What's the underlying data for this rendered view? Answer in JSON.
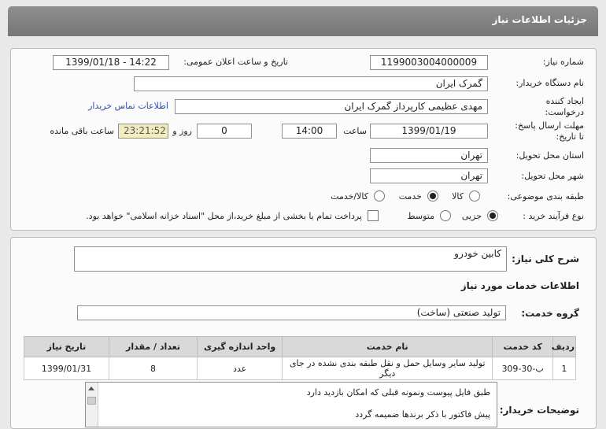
{
  "header": {
    "title": "جزئیات اطلاعات نیاز"
  },
  "need_number": {
    "label": "شماره نیاز:",
    "value": "1199003004000009"
  },
  "announce": {
    "label": "تاریخ و ساعت اعلان عمومی:",
    "value": "1399/01/18 - 14:22"
  },
  "buyer_org": {
    "label": "نام دستگاه خریدار:",
    "value": "گمرک ایران"
  },
  "requester": {
    "label_line1": "ایجاد کننده",
    "label_line2": "درخواست:",
    "value": "مهدی عظیمی کارپرداز گمرک ایران",
    "contact_link": "اطلاعات تماس خریدار"
  },
  "deadline": {
    "label_line1": "مهلت ارسال پاسخ:",
    "label_line2": "تا تاریخ:",
    "date": "1399/01/19",
    "time_label": "ساعت",
    "time": "14:00",
    "days": "0",
    "days_label": "روز و",
    "remaining": "23:21:52",
    "remaining_label": "ساعت باقی مانده"
  },
  "province": {
    "label": "استان محل تحویل:",
    "value": "تهران"
  },
  "city": {
    "label": "شهر محل تحویل:",
    "value": "تهران"
  },
  "category": {
    "label": "طبقه بندی موضوعی:",
    "options": [
      "کالا",
      "خدمت",
      "کالا/خدمت"
    ],
    "selected": "خدمت"
  },
  "purchase_type": {
    "label": "نوع فرآیند خرید :",
    "options": [
      "جزیی",
      "متوسط"
    ],
    "selected": "جزیی",
    "treasury_note": "پرداخت تمام یا بخشی از مبلغ خرید،از محل \"اسناد خزانه اسلامی\" خواهد بود."
  },
  "summary": {
    "label": "شرح کلی نیاز:",
    "value": "کابین خودرو"
  },
  "services_title": "اطلاعات خدمات مورد نیاز",
  "service_group": {
    "label": "گروه خدمت:",
    "value": "تولید صنعتی (ساخت)"
  },
  "table": {
    "headers": [
      "ردیف",
      "کد خدمت",
      "نام خدمت",
      "واحد اندازه گیری",
      "تعداد / مقدار",
      "تاریخ نیاز"
    ],
    "rows": [
      [
        "1",
        "ب-30-309",
        "تولید سایر وسایل حمل و نقل طبقه بندی نشده در جای دیگر",
        "عدد",
        "8",
        "1399/01/31"
      ]
    ]
  },
  "buyer_notes": {
    "label": "توضیحات خریدار:",
    "lines": [
      "طبق فایل پیوست ونمونه قبلی که امکان بازدید دارد",
      "پیش فاکتور با ذکر برندها ضمیمه گردد"
    ]
  },
  "colors": {
    "header": "#7f7f7f",
    "link": "#2a4fb5",
    "time_bg": "#f3ecc2"
  }
}
